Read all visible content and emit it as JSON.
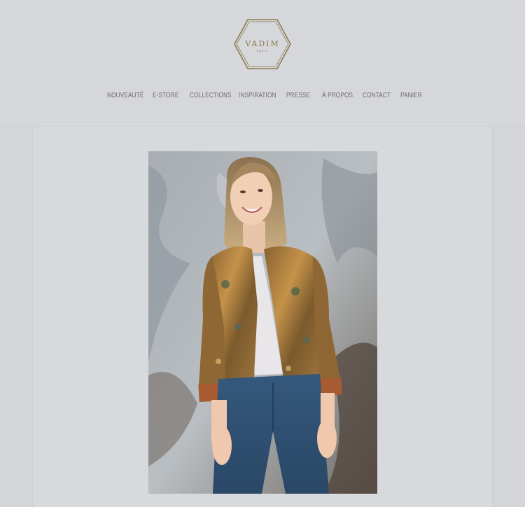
{
  "brand": {
    "name": "VADIM",
    "subtitle": "PARIS",
    "accent_color": "#8c7a52"
  },
  "nav": {
    "items": [
      {
        "label": "NOUVEAUTÉ"
      },
      {
        "label": "E-STORE"
      },
      {
        "label": "COLLECTIONS"
      },
      {
        "label": "INSPIRATION"
      },
      {
        "label": "PRESSE"
      },
      {
        "label": "À PROPOS"
      },
      {
        "label": "CONTACT"
      },
      {
        "label": "PANIER"
      }
    ],
    "text_color": "#6b6a6a"
  },
  "main": {
    "image": {
      "icon": "product-photo"
    }
  }
}
